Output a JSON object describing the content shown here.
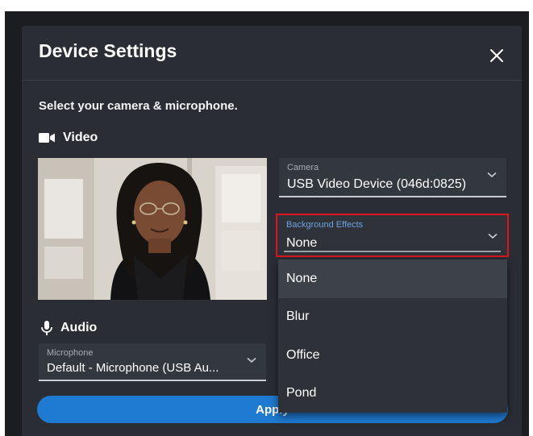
{
  "dialog": {
    "title": "Device Settings",
    "subtitle": "Select your camera & microphone."
  },
  "video": {
    "heading": "Video",
    "camera": {
      "label": "Camera",
      "value": "USB Video Device (046d:0825)"
    },
    "background_effects": {
      "label": "Background Effects",
      "value": "None",
      "options": [
        "None",
        "Blur",
        "Office",
        "Pond"
      ],
      "selected": "None"
    }
  },
  "audio": {
    "heading": "Audio",
    "microphone": {
      "label": "Microphone",
      "value": "Default - Microphone (USB Au..."
    }
  },
  "apply_label": "Apply",
  "colors": {
    "dialog_bg": "#2a2d33",
    "accent": "#1f7ad1",
    "highlight_border": "#e0141e",
    "label_blue": "#6ca3e3"
  },
  "icons": {
    "close": "close-icon",
    "video": "video-camera-icon",
    "audio": "microphone-icon",
    "dropdown": "chevron-down-icon"
  }
}
